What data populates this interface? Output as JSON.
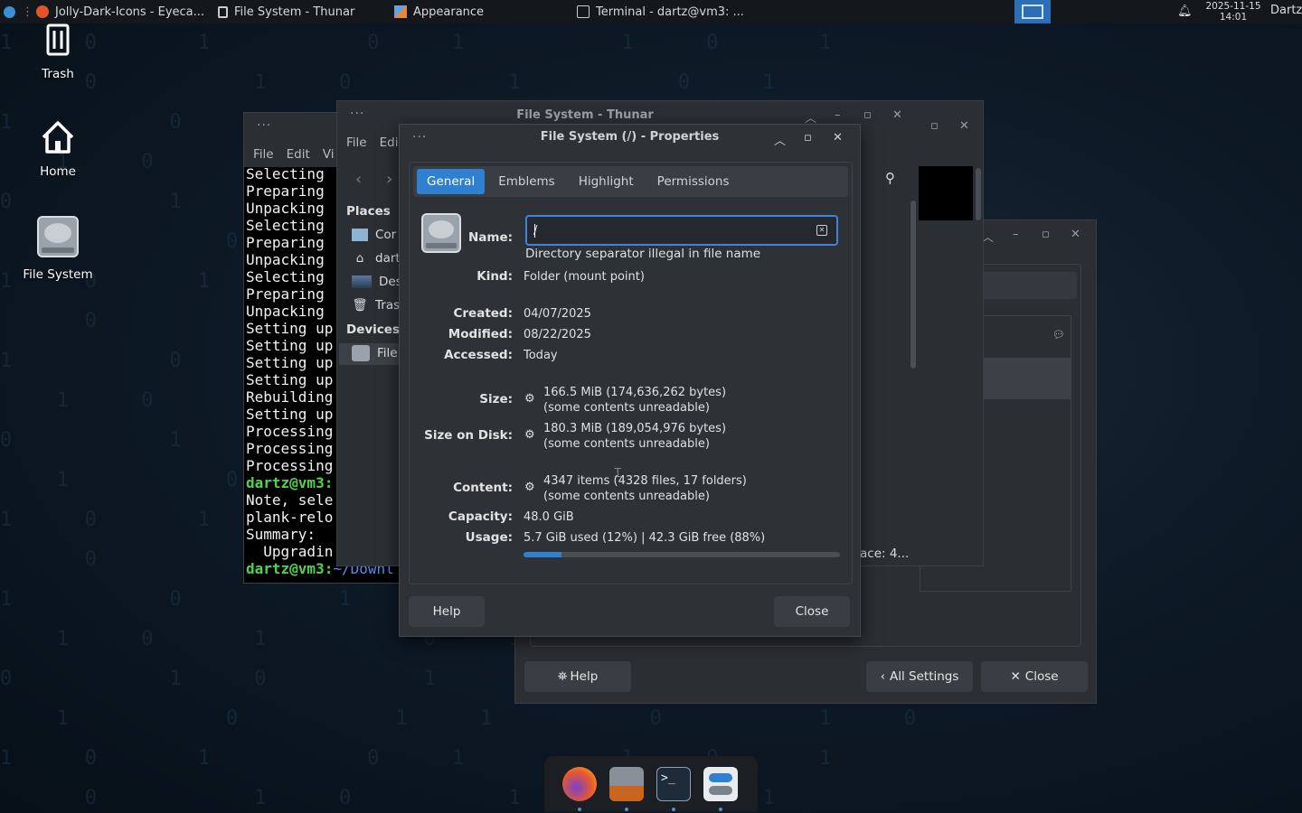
{
  "panel": {
    "tasks": [
      {
        "label": "Jolly-Dark-Icons - Eyeca...",
        "icon": "firefox-icon"
      },
      {
        "label": "File System - Thunar",
        "icon": "file-manager-icon"
      },
      {
        "label": "Appearance",
        "icon": "appearance-icon"
      },
      {
        "label": "Terminal - dartz@vm3: ...",
        "icon": "terminal-icon"
      }
    ],
    "clock_date": "2025-11-15",
    "clock_time": "14:01",
    "user": "Dartz"
  },
  "desktop": {
    "icons": [
      {
        "label": "Trash",
        "icon": "trash-icon"
      },
      {
        "label": "Home",
        "icon": "home-icon"
      },
      {
        "label": "File System",
        "icon": "drive-icon"
      }
    ]
  },
  "terminal": {
    "menu": [
      "File",
      "Edit",
      "Vi"
    ],
    "lines": [
      "Selecting",
      "Preparing",
      "Unpacking",
      "Selecting",
      "Preparing",
      "Unpacking",
      "Selecting",
      "Preparing",
      "Unpacking",
      "Setting up",
      "Setting up",
      "Setting up",
      "Setting up",
      "Rebuilding",
      "Setting up",
      "Processing",
      "Processing",
      "Processing"
    ],
    "prompt1": "dartz@vm3:",
    "line_note": "Note, sele",
    "line_plank": "plank-relo",
    "line_summary": "Summary:",
    "line_upgrading": "  Upgradin",
    "prompt2_user": "dartz@vm3:",
    "prompt2_path": "~/Downl"
  },
  "thunar": {
    "title": "File System - Thunar",
    "menu": [
      "File",
      "Edi"
    ],
    "places_label": "Places",
    "places": [
      "Cor",
      "dart",
      "Des",
      "Tras"
    ],
    "devices_label": "Devices",
    "devices": [
      "File"
    ],
    "status_fragment": "ace: 4..."
  },
  "appearance": {
    "help_label": "Help",
    "all_settings_label": "All Settings",
    "close_label": "Close"
  },
  "properties": {
    "title": "File System (/) - Properties",
    "tabs": [
      "General",
      "Emblems",
      "Highlight",
      "Permissions"
    ],
    "name_label": "Name:",
    "name_value": "/",
    "name_error": "Directory separator illegal in file name",
    "kind_label": "Kind:",
    "kind_value": "Folder (mount point)",
    "created_label": "Created:",
    "created_value": "04/07/2025",
    "modified_label": "Modified:",
    "modified_value": "08/22/2025",
    "accessed_label": "Accessed:",
    "accessed_value": "Today",
    "size_label": "Size:",
    "size_value": "166.5 MiB (174,636,262 bytes)",
    "size_note": "(some contents unreadable)",
    "disk_label": "Size on Disk:",
    "disk_value": "180.3 MiB (189,054,976 bytes)",
    "disk_note": "(some contents unreadable)",
    "content_label": "Content:",
    "content_value": "4347 items (4328 files, 17 folders)",
    "content_note": "(some contents unreadable)",
    "capacity_label": "Capacity:",
    "capacity_value": "48.0 GiB",
    "usage_label": "Usage:",
    "usage_value": "5.7 GiB used (12%)  |  42.3 GiB free (88%)",
    "usage_fraction": 0.12,
    "help_label": "Help",
    "close_label": "Close"
  },
  "dock": {
    "items": [
      "firefox-icon",
      "appearance-icon",
      "terminal-icon",
      "settings-icon"
    ]
  },
  "colors": {
    "accent": "#2f80d1",
    "prompt_green": "#4fd44f",
    "path_blue": "#5c8cf0"
  }
}
